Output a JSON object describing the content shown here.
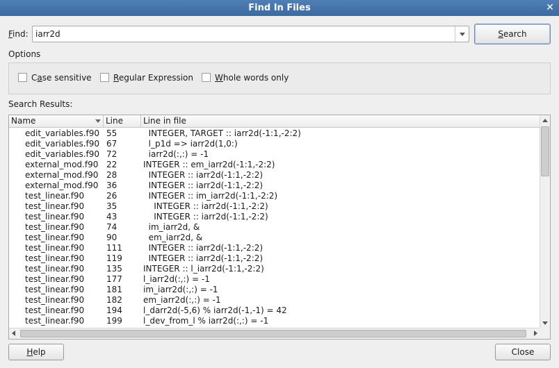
{
  "window": {
    "title": "Find In Files"
  },
  "find": {
    "label": "Find:",
    "label_mnemonic": "F",
    "label_rest": "ind:",
    "value": "iarr2d"
  },
  "buttons": {
    "search_mnemonic": "S",
    "search_rest": "earch",
    "help_mnemonic": "H",
    "help_rest": "elp",
    "close": "Close"
  },
  "options": {
    "label": "Options",
    "case_sensitive": {
      "mnemonic": "a",
      "before": "C",
      "after": "se sensitive",
      "checked": false
    },
    "regex": {
      "mnemonic": "R",
      "before": "",
      "after": "egular Expression",
      "checked": false
    },
    "whole_words": {
      "mnemonic": "W",
      "before": "",
      "after": "hole words only",
      "checked": false
    }
  },
  "results": {
    "label": "Search Results:",
    "columns": {
      "name": "Name",
      "line": "Line",
      "file": "Line in file"
    },
    "rows": [
      {
        "name": "edit_variables.f90",
        "line": "55",
        "text": "  INTEGER, TARGET :: iarr2d(-1:1,-2:2)"
      },
      {
        "name": "edit_variables.f90",
        "line": "67",
        "text": "  l_p1d => iarr2d(1,0:)"
      },
      {
        "name": "edit_variables.f90",
        "line": "72",
        "text": "  iarr2d(:,:) = -1"
      },
      {
        "name": "external_mod.f90",
        "line": "22",
        "text": "INTEGER :: em_iarr2d(-1:1,-2:2)"
      },
      {
        "name": "external_mod.f90",
        "line": "28",
        "text": "  INTEGER :: iarr2d(-1:1,-2:2)"
      },
      {
        "name": "external_mod.f90",
        "line": "36",
        "text": "  INTEGER :: iarr2d(-1:1,-2:2)"
      },
      {
        "name": "test_linear.f90",
        "line": "26",
        "text": "  INTEGER :: im_iarr2d(-1:1,-2:2)"
      },
      {
        "name": "test_linear.f90",
        "line": "35",
        "text": "    INTEGER :: iarr2d(-1:1,-2:2)"
      },
      {
        "name": "test_linear.f90",
        "line": "43",
        "text": "    INTEGER :: iarr2d(-1:1,-2:2)"
      },
      {
        "name": "test_linear.f90",
        "line": "74",
        "text": "  im_iarr2d, &"
      },
      {
        "name": "test_linear.f90",
        "line": "90",
        "text": "  em_iarr2d, &"
      },
      {
        "name": "test_linear.f90",
        "line": "111",
        "text": "  INTEGER :: iarr2d(-1:1,-2:2)"
      },
      {
        "name": "test_linear.f90",
        "line": "119",
        "text": "  INTEGER :: iarr2d(-1:1,-2:2)"
      },
      {
        "name": "test_linear.f90",
        "line": "135",
        "text": "INTEGER :: l_iarr2d(-1:1,-2:2)"
      },
      {
        "name": "test_linear.f90",
        "line": "177",
        "text": "l_iarr2d(:,:) = -1"
      },
      {
        "name": "test_linear.f90",
        "line": "181",
        "text": "im_iarr2d(:,:) = -1"
      },
      {
        "name": "test_linear.f90",
        "line": "182",
        "text": "em_iarr2d(:,:) = -1"
      },
      {
        "name": "test_linear.f90",
        "line": "194",
        "text": "l_darr2d(-5,6) % iarr2d(-1,-1) = 42"
      },
      {
        "name": "test_linear.f90",
        "line": "199",
        "text": "l_dev_from_l % iarr2d(:,:) = -1"
      }
    ]
  }
}
